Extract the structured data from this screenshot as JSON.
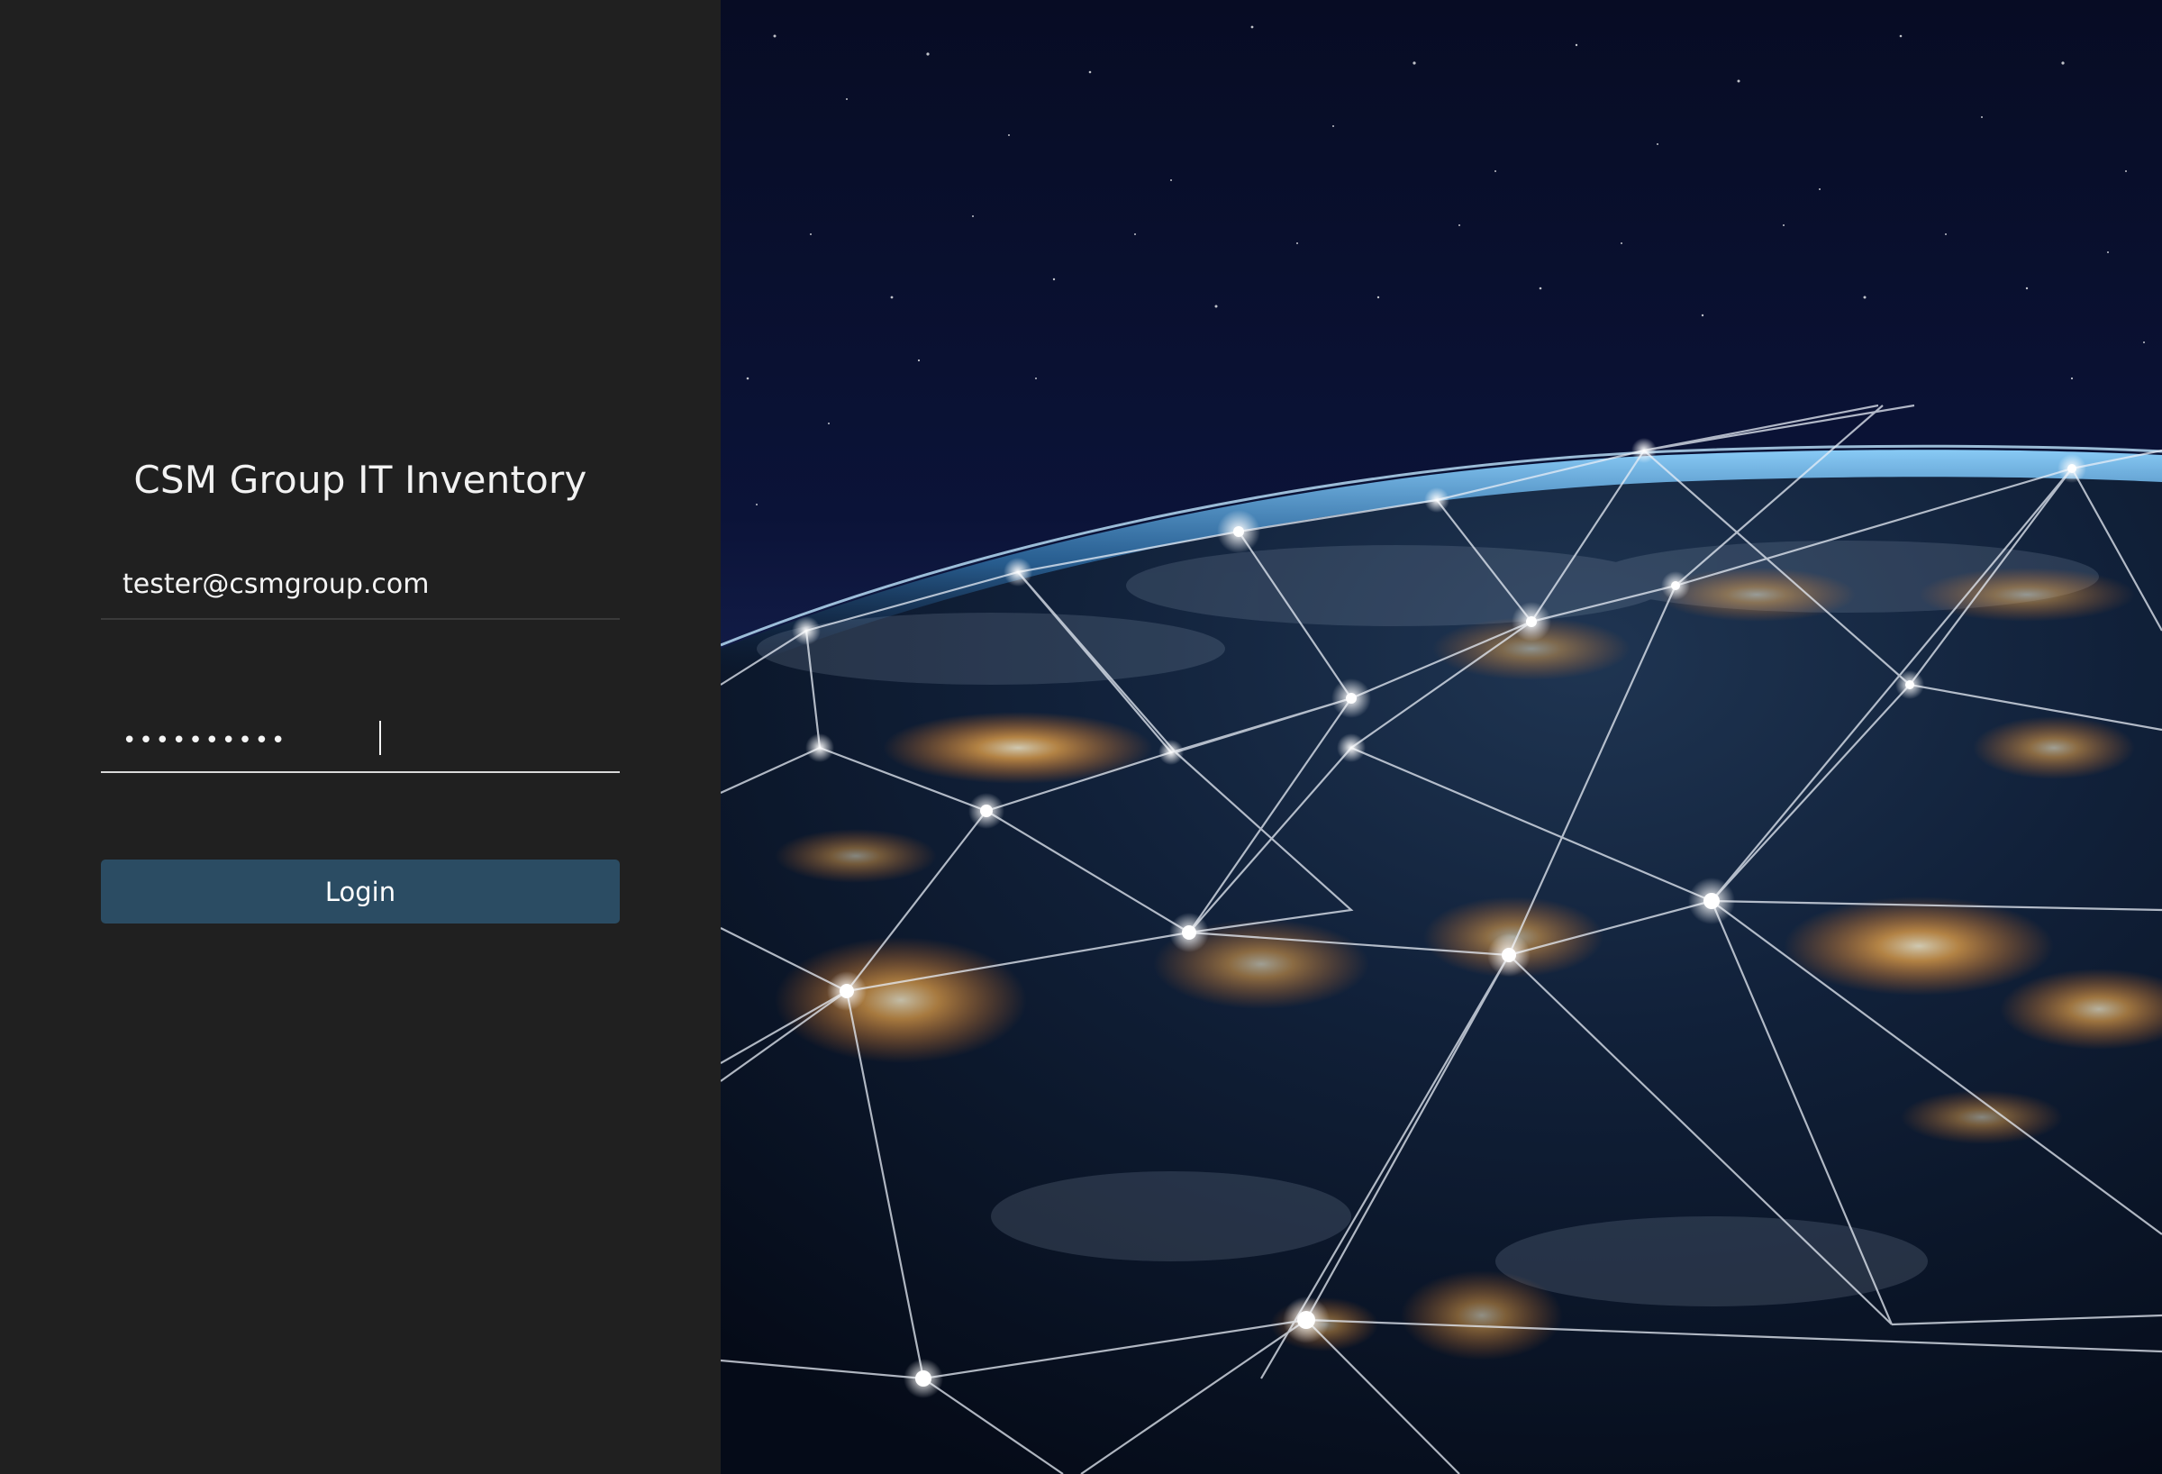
{
  "app": {
    "title": "CSM Group IT Inventory"
  },
  "login_form": {
    "email_value": "tester@csmgroup.com",
    "password_value": "••••••••••",
    "login_label": "Login"
  },
  "hero": {
    "image": "earth-at-night-network-image"
  },
  "colors": {
    "background": "#202020",
    "button": "#2b4c63",
    "text": "#f2f2f2"
  }
}
